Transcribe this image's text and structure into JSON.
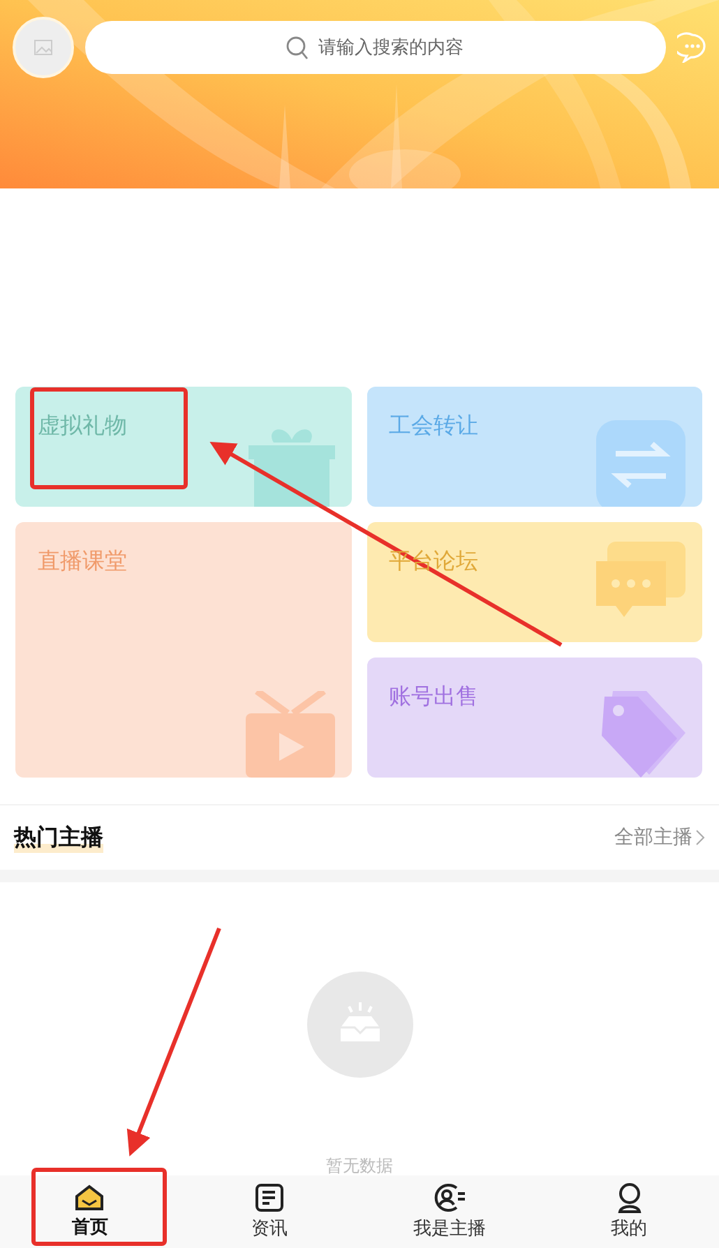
{
  "header": {
    "search": {
      "placeholder": "请输入搜索的内容"
    }
  },
  "cards": [
    {
      "label": "虚拟礼物",
      "kind": "gift",
      "color": "#6fb8a8",
      "tall": false
    },
    {
      "label": "工会转让",
      "kind": "swap",
      "color": "#5aa9e6",
      "tall": false
    },
    {
      "label": "直播课堂",
      "kind": "tv",
      "color": "#f09a6a",
      "tall": true
    },
    {
      "label": "平台论坛",
      "kind": "chat",
      "color": "#e0a838",
      "tall": false
    },
    {
      "label": "账号出售",
      "kind": "tag",
      "color": "#a070e0",
      "tall": false
    }
  ],
  "section": {
    "title": "热门主播",
    "link": "全部主播"
  },
  "empty": {
    "text": "暂无数据"
  },
  "tabs": [
    {
      "label": "首页",
      "kind": "home",
      "selected": true
    },
    {
      "label": "资讯",
      "kind": "news",
      "selected": false
    },
    {
      "label": "我是主播",
      "kind": "anchor",
      "selected": false
    },
    {
      "label": "我的",
      "kind": "user",
      "selected": false
    }
  ]
}
